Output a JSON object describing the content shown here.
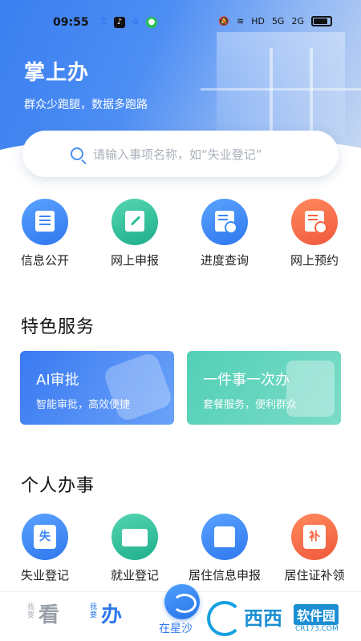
{
  "status_bar": {
    "time": "09:55",
    "network_badges": [
      "HD",
      "5G",
      "2G"
    ]
  },
  "header": {
    "title": "掌上办",
    "subtitle": "群众少跑腿，数据多跑路"
  },
  "search": {
    "placeholder": "请输入事项名称，如“失业登记”",
    "icon": "search-icon"
  },
  "quick_actions": [
    {
      "label": "信息公开",
      "icon": "document-icon",
      "color": "#3b86f2"
    },
    {
      "label": "网上申报",
      "icon": "edit-icon",
      "color": "#2bbf98"
    },
    {
      "label": "进度查询",
      "icon": "clock-doc-icon",
      "color": "#3b86f2"
    },
    {
      "label": "网上预约",
      "icon": "calendar-clock-icon",
      "color": "#f4633e"
    }
  ],
  "featured": {
    "title": "特色服务",
    "cards": [
      {
        "title": "AI审批",
        "subtitle": "智能审批，高效便捷"
      },
      {
        "title": "一件事一次办",
        "subtitle": "套餐服务，便利群众"
      }
    ]
  },
  "personal": {
    "title": "个人办事",
    "items": [
      {
        "label": "失业登记",
        "icon": "unemployment-icon",
        "glyph": "失",
        "color": "#3b86f2"
      },
      {
        "label": "就业登记",
        "icon": "briefcase-icon",
        "glyph": "",
        "color": "#2bbf98"
      },
      {
        "label": "居住信息申报",
        "icon": "house-icon",
        "glyph": "",
        "color": "#3b86f2"
      },
      {
        "label": "居住证补领",
        "icon": "reissue-icon",
        "glyph": "补",
        "color": "#f4633e"
      }
    ]
  },
  "tabbar": {
    "tab1_small": "我要",
    "tab1_big": "看",
    "tab2_small": "我要",
    "tab2_big": "办",
    "center_label": "在星沙"
  },
  "watermark": {
    "brand": "西西",
    "tag": "软件园",
    "domain": "CR173.COM"
  }
}
